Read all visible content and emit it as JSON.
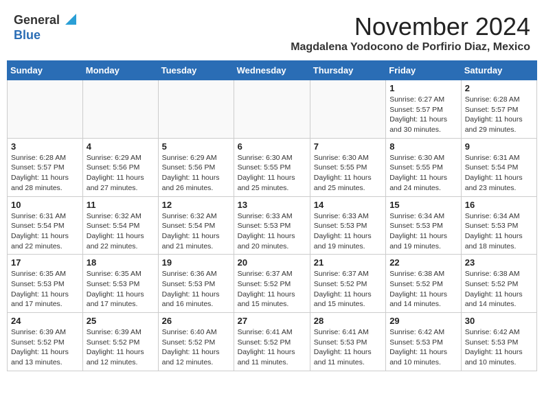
{
  "header": {
    "logo_general": "General",
    "logo_blue": "Blue",
    "month": "November 2024",
    "location": "Magdalena Yodocono de Porfirio Diaz, Mexico"
  },
  "weekdays": [
    "Sunday",
    "Monday",
    "Tuesday",
    "Wednesday",
    "Thursday",
    "Friday",
    "Saturday"
  ],
  "weeks": [
    [
      {
        "day": "",
        "info": ""
      },
      {
        "day": "",
        "info": ""
      },
      {
        "day": "",
        "info": ""
      },
      {
        "day": "",
        "info": ""
      },
      {
        "day": "",
        "info": ""
      },
      {
        "day": "1",
        "info": "Sunrise: 6:27 AM\nSunset: 5:57 PM\nDaylight: 11 hours\nand 30 minutes."
      },
      {
        "day": "2",
        "info": "Sunrise: 6:28 AM\nSunset: 5:57 PM\nDaylight: 11 hours\nand 29 minutes."
      }
    ],
    [
      {
        "day": "3",
        "info": "Sunrise: 6:28 AM\nSunset: 5:57 PM\nDaylight: 11 hours\nand 28 minutes."
      },
      {
        "day": "4",
        "info": "Sunrise: 6:29 AM\nSunset: 5:56 PM\nDaylight: 11 hours\nand 27 minutes."
      },
      {
        "day": "5",
        "info": "Sunrise: 6:29 AM\nSunset: 5:56 PM\nDaylight: 11 hours\nand 26 minutes."
      },
      {
        "day": "6",
        "info": "Sunrise: 6:30 AM\nSunset: 5:55 PM\nDaylight: 11 hours\nand 25 minutes."
      },
      {
        "day": "7",
        "info": "Sunrise: 6:30 AM\nSunset: 5:55 PM\nDaylight: 11 hours\nand 25 minutes."
      },
      {
        "day": "8",
        "info": "Sunrise: 6:30 AM\nSunset: 5:55 PM\nDaylight: 11 hours\nand 24 minutes."
      },
      {
        "day": "9",
        "info": "Sunrise: 6:31 AM\nSunset: 5:54 PM\nDaylight: 11 hours\nand 23 minutes."
      }
    ],
    [
      {
        "day": "10",
        "info": "Sunrise: 6:31 AM\nSunset: 5:54 PM\nDaylight: 11 hours\nand 22 minutes."
      },
      {
        "day": "11",
        "info": "Sunrise: 6:32 AM\nSunset: 5:54 PM\nDaylight: 11 hours\nand 22 minutes."
      },
      {
        "day": "12",
        "info": "Sunrise: 6:32 AM\nSunset: 5:54 PM\nDaylight: 11 hours\nand 21 minutes."
      },
      {
        "day": "13",
        "info": "Sunrise: 6:33 AM\nSunset: 5:53 PM\nDaylight: 11 hours\nand 20 minutes."
      },
      {
        "day": "14",
        "info": "Sunrise: 6:33 AM\nSunset: 5:53 PM\nDaylight: 11 hours\nand 19 minutes."
      },
      {
        "day": "15",
        "info": "Sunrise: 6:34 AM\nSunset: 5:53 PM\nDaylight: 11 hours\nand 19 minutes."
      },
      {
        "day": "16",
        "info": "Sunrise: 6:34 AM\nSunset: 5:53 PM\nDaylight: 11 hours\nand 18 minutes."
      }
    ],
    [
      {
        "day": "17",
        "info": "Sunrise: 6:35 AM\nSunset: 5:53 PM\nDaylight: 11 hours\nand 17 minutes."
      },
      {
        "day": "18",
        "info": "Sunrise: 6:35 AM\nSunset: 5:53 PM\nDaylight: 11 hours\nand 17 minutes."
      },
      {
        "day": "19",
        "info": "Sunrise: 6:36 AM\nSunset: 5:53 PM\nDaylight: 11 hours\nand 16 minutes."
      },
      {
        "day": "20",
        "info": "Sunrise: 6:37 AM\nSunset: 5:52 PM\nDaylight: 11 hours\nand 15 minutes."
      },
      {
        "day": "21",
        "info": "Sunrise: 6:37 AM\nSunset: 5:52 PM\nDaylight: 11 hours\nand 15 minutes."
      },
      {
        "day": "22",
        "info": "Sunrise: 6:38 AM\nSunset: 5:52 PM\nDaylight: 11 hours\nand 14 minutes."
      },
      {
        "day": "23",
        "info": "Sunrise: 6:38 AM\nSunset: 5:52 PM\nDaylight: 11 hours\nand 14 minutes."
      }
    ],
    [
      {
        "day": "24",
        "info": "Sunrise: 6:39 AM\nSunset: 5:52 PM\nDaylight: 11 hours\nand 13 minutes."
      },
      {
        "day": "25",
        "info": "Sunrise: 6:39 AM\nSunset: 5:52 PM\nDaylight: 11 hours\nand 12 minutes."
      },
      {
        "day": "26",
        "info": "Sunrise: 6:40 AM\nSunset: 5:52 PM\nDaylight: 11 hours\nand 12 minutes."
      },
      {
        "day": "27",
        "info": "Sunrise: 6:41 AM\nSunset: 5:52 PM\nDaylight: 11 hours\nand 11 minutes."
      },
      {
        "day": "28",
        "info": "Sunrise: 6:41 AM\nSunset: 5:53 PM\nDaylight: 11 hours\nand 11 minutes."
      },
      {
        "day": "29",
        "info": "Sunrise: 6:42 AM\nSunset: 5:53 PM\nDaylight: 11 hours\nand 10 minutes."
      },
      {
        "day": "30",
        "info": "Sunrise: 6:42 AM\nSunset: 5:53 PM\nDaylight: 11 hours\nand 10 minutes."
      }
    ]
  ]
}
